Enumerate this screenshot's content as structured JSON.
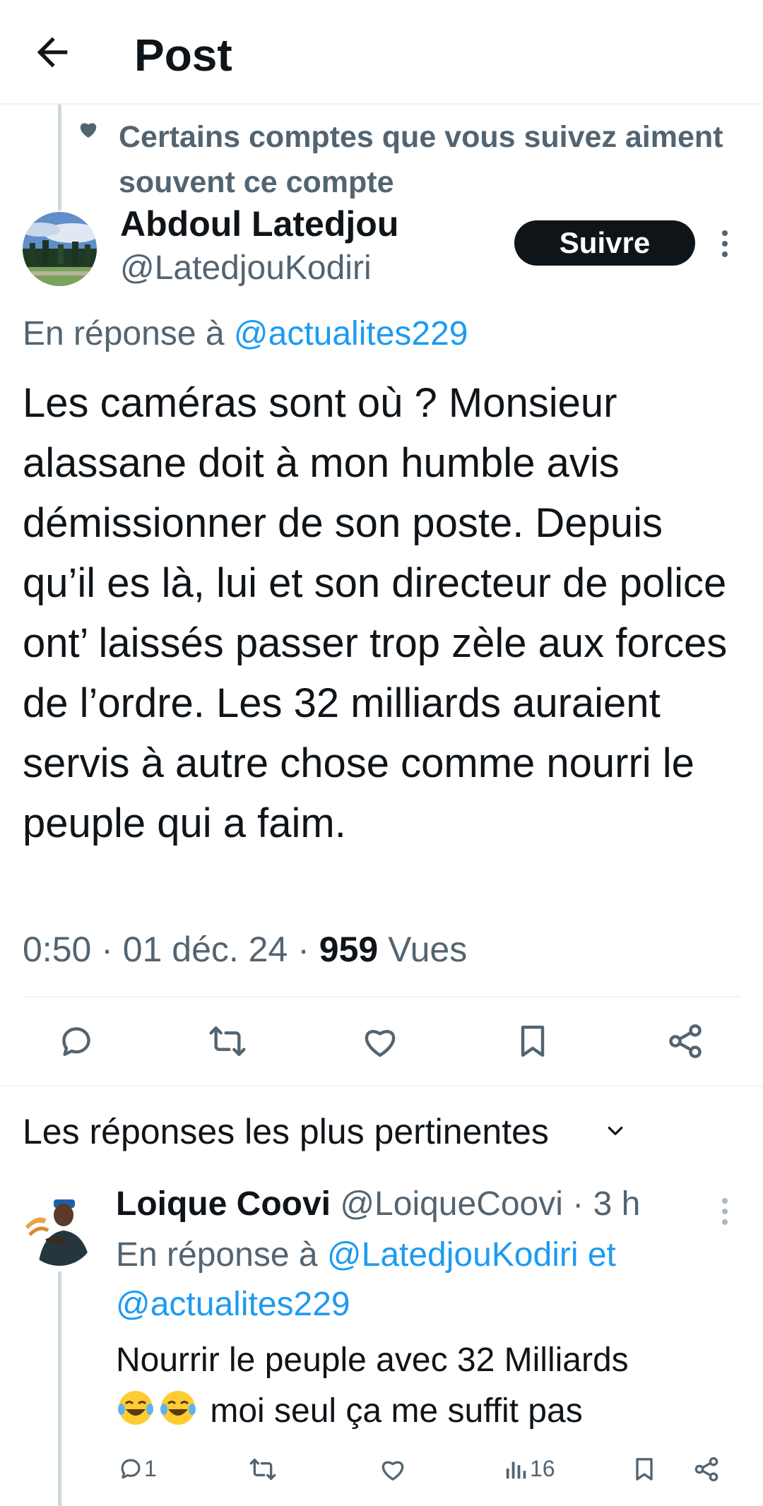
{
  "header": {
    "title": "Post",
    "back_icon": "arrow-left-icon"
  },
  "social_context": {
    "icon": "heart-icon",
    "text": "Certains comptes que vous suivez aiment souvent ce compte"
  },
  "author": {
    "name": "Abdoul Latedjou",
    "handle": "@LatedjouKodiri",
    "follow_label": "Suivre"
  },
  "reply_to": {
    "prefix": "En réponse à",
    "mention": "@actualites229"
  },
  "tweet": {
    "text": "Les caméras sont où ? Monsieur alassane doit à mon humble avis démissionner de son poste. Depuis qu’il es là, lui et son directeur de police ont’ laissés passer trop zèle aux forces de l’ordre. Les 32 milliards auraient servis à autre chose comme nourri le peuple qui a faim.",
    "time": "0:50",
    "date": "01 déc. 24",
    "views_count": "959",
    "views_label": "Vues"
  },
  "actions": [
    "reply-icon",
    "retweet-icon",
    "like-icon",
    "bookmark-icon",
    "share-icon"
  ],
  "sort": {
    "label": "Les réponses les plus pertinentes"
  },
  "reply": {
    "name": "Loique Coovi",
    "handle": "@LoiqueCoovi",
    "sep": "·",
    "time": "3 h",
    "reply_prefix": "En réponse à",
    "reply_mentions": "@LatedjouKodiri et @actualites229",
    "text": "Nourrir le peuple avec 32 Milliards",
    "text_after_emoji": "moi seul ça me suffit pas",
    "reply_count": "1",
    "views_count": "16"
  },
  "colors": {
    "accent": "#1d9bf0",
    "muted": "#536471",
    "text": "#0f1419",
    "divider": "#eff3f4"
  }
}
